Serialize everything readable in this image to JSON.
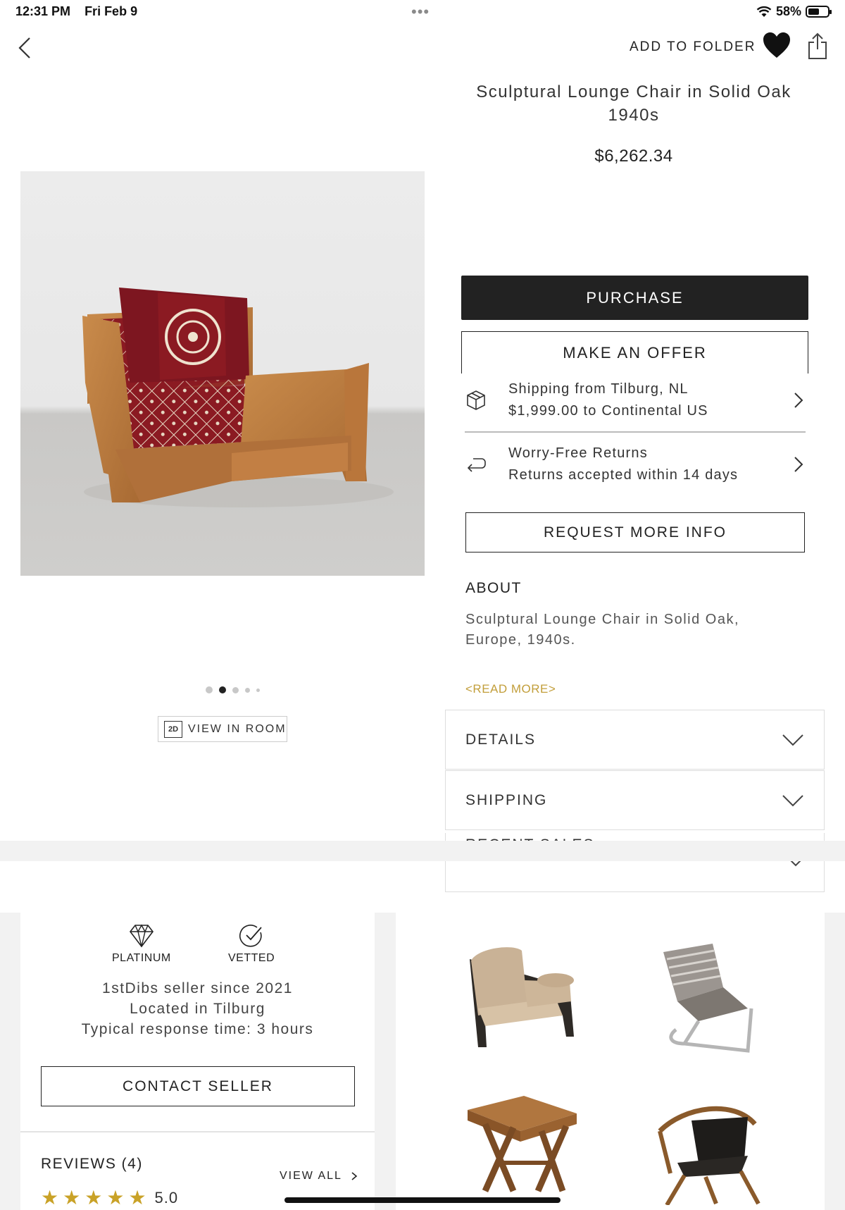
{
  "status_bar": {
    "time": "12:31 PM",
    "date": "Fri Feb 9",
    "battery": "58%",
    "battery_level": 0.58,
    "icons": [
      "wifi-icon",
      "battery-icon"
    ]
  },
  "top_bar": {
    "add_to_folder": "ADD TO FOLDER",
    "icons": [
      "back-icon",
      "heart-icon",
      "share-icon"
    ]
  },
  "product": {
    "title_line1": "Sculptural Lounge Chair in Solid Oak",
    "title_line2": "1940s",
    "price": "$6,262.34"
  },
  "gallery": {
    "image_count": 5,
    "active_index": 1,
    "view_in_room_badge": "2D",
    "view_in_room": "VIEW IN ROOM"
  },
  "actions": {
    "purchase": "PURCHASE",
    "make_offer": "MAKE AN OFFER",
    "request_info": "REQUEST MORE INFO"
  },
  "shipping_row": {
    "line1": "Shipping from Tilburg, NL",
    "line2": "$1,999.00 to Continental US",
    "icon": "box-icon"
  },
  "returns_row": {
    "line1": "Worry-Free Returns",
    "line2": "Returns accepted within 14 days",
    "icon": "return-arrow-icon"
  },
  "about": {
    "heading": "ABOUT",
    "line1": "Sculptural Lounge Chair in Solid Oak,",
    "line2": "Europe, 1940s.",
    "read_more": "<READ MORE>"
  },
  "accordions": {
    "details": "DETAILS",
    "shipping": "SHIPPING",
    "recent_sales": "RECENT SALES"
  },
  "seller": {
    "badge_platinum": "PLATINUM",
    "badge_vetted": "VETTED",
    "since": "1stDibs seller since 2021",
    "location": "Located in Tilburg",
    "response": "Typical response time: 3 hours",
    "contact": "CONTACT SELLER"
  },
  "reviews": {
    "heading": "REVIEWS (4)",
    "view_all": "VIEW ALL",
    "rating": "5.0",
    "stars": 5
  },
  "colors": {
    "accent_gold": "#c29e3a",
    "star_gold": "#c9a227",
    "primary_dark": "#222222"
  }
}
